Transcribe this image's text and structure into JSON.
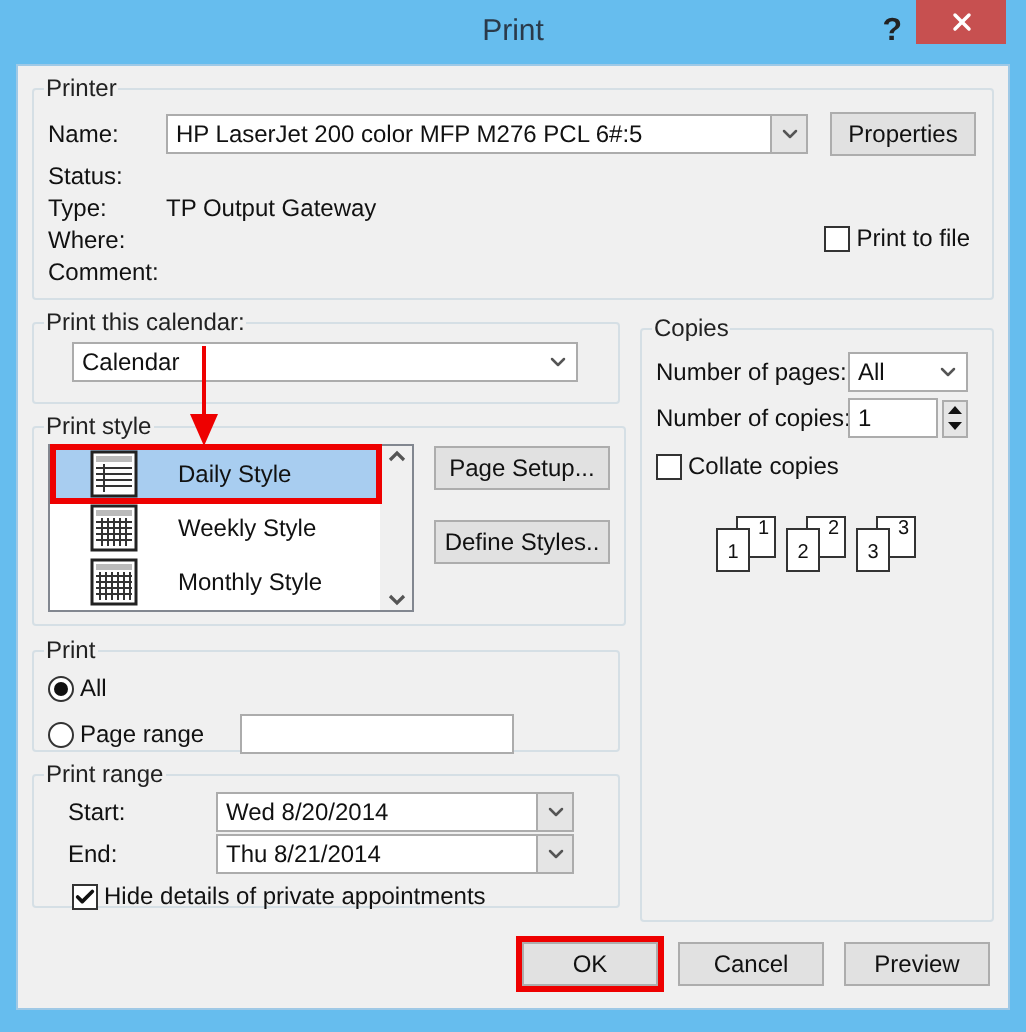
{
  "window": {
    "title": "Print",
    "help": "?"
  },
  "printer": {
    "legend": "Printer",
    "name_label": "Name:",
    "name_value": "HP LaserJet 200 color MFP M276 PCL 6#:5",
    "properties": "Properties",
    "info": [
      {
        "label": "Status:"
      },
      {
        "label": "Type:",
        "value": "TP Output Gateway"
      },
      {
        "label": "Where:"
      },
      {
        "label": "Comment:"
      }
    ],
    "print_to_file": {
      "label": "Print to file",
      "checked": false
    }
  },
  "calendar": {
    "legend": "Print this calendar:",
    "value": "Calendar"
  },
  "print_style": {
    "legend": "Print style",
    "items": [
      {
        "label": "Daily Style",
        "kind": "daily",
        "selected": true
      },
      {
        "label": "Weekly Style",
        "kind": "weekly",
        "selected": false
      },
      {
        "label": "Monthly Style",
        "kind": "monthly",
        "selected": false
      }
    ],
    "buttons": [
      "Page Setup...",
      "Define Styles.."
    ]
  },
  "copies": {
    "legend": "Copies",
    "pages_label": "Number of pages:",
    "pages_value": "All",
    "copies_label": "Number of copies:",
    "copies_value": "1",
    "collate": {
      "label": "Collate copies",
      "checked": false
    },
    "sets": [
      {
        "back": "1",
        "front": "1"
      },
      {
        "back": "2",
        "front": "2"
      },
      {
        "back": "3",
        "front": "3"
      }
    ]
  },
  "print": {
    "legend": "Print",
    "options": [
      {
        "label": "All",
        "selected": true
      },
      {
        "label": "Page range",
        "selected": false
      }
    ]
  },
  "print_range": {
    "legend": "Print range",
    "start_label": "Start:",
    "start_value": "Wed 8/20/2014",
    "end_label": "End:",
    "end_value": "Thu 8/21/2014",
    "hide_private": {
      "label": "Hide details of private appointments",
      "checked": true
    }
  },
  "buttons": [
    {
      "label": "OK",
      "highlighted": true
    },
    {
      "label": "Cancel",
      "highlighted": false
    },
    {
      "label": "Preview",
      "highlighted": false
    }
  ]
}
